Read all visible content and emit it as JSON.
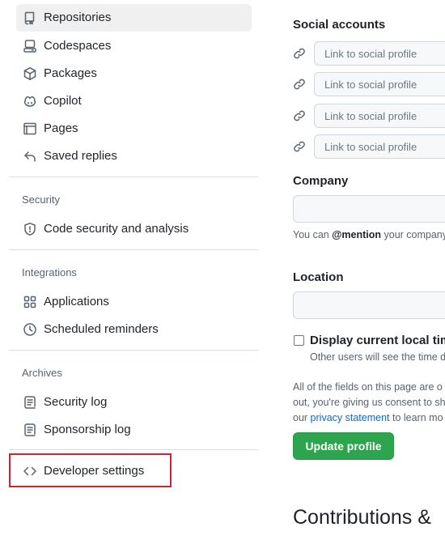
{
  "sidebar": {
    "items": [
      {
        "label": "Repositories",
        "icon": "repo-icon",
        "active": true
      },
      {
        "label": "Codespaces",
        "icon": "codespaces-icon"
      },
      {
        "label": "Packages",
        "icon": "package-icon"
      },
      {
        "label": "Copilot",
        "icon": "copilot-icon"
      },
      {
        "label": "Pages",
        "icon": "pages-icon"
      },
      {
        "label": "Saved replies",
        "icon": "reply-icon"
      }
    ],
    "security": {
      "heading": "Security",
      "items": [
        {
          "label": "Code security and analysis",
          "icon": "shield-icon"
        }
      ]
    },
    "integrations": {
      "heading": "Integrations",
      "items": [
        {
          "label": "Applications",
          "icon": "apps-icon"
        },
        {
          "label": "Scheduled reminders",
          "icon": "clock-icon"
        }
      ]
    },
    "archives": {
      "heading": "Archives",
      "items": [
        {
          "label": "Security log",
          "icon": "log-icon"
        },
        {
          "label": "Sponsorship log",
          "icon": "log-icon"
        }
      ]
    },
    "developer_settings": {
      "label": "Developer settings",
      "icon": "code-icon",
      "highlight_color": "#cf222e"
    }
  },
  "main": {
    "social": {
      "heading": "Social accounts",
      "placeholder": "Link to social profile",
      "inputs": [
        "",
        "",
        "",
        ""
      ]
    },
    "company": {
      "heading": "Company",
      "value": "",
      "hint_prefix": "You can ",
      "hint_mention": "@mention",
      "hint_suffix": " your company"
    },
    "location": {
      "heading": "Location",
      "value": ""
    },
    "local_time": {
      "label": "Display current local time",
      "note": "Other users will see the time d",
      "checked": false
    },
    "consent": {
      "line1": "All of the fields on this page are o",
      "line2": "out, you're giving us consent to sh",
      "line3_prefix": "our ",
      "privacy_link": "privacy statement",
      "line3_suffix": " to learn mo"
    },
    "update_button": "Update profile",
    "next_section_title": "Contributions &"
  },
  "colors": {
    "accent_green": "#2da44e",
    "link_blue": "#0969da",
    "highlight_red": "#cf222e",
    "active_bg": "#f0f0f0"
  }
}
